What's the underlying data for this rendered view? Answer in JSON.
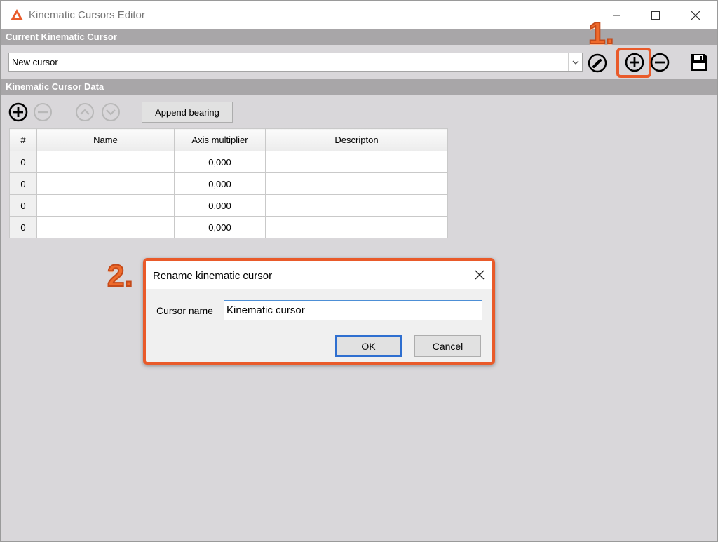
{
  "window": {
    "title": "Kinematic Cursors Editor"
  },
  "sections": {
    "current": "Current Kinematic Cursor",
    "data": "Kinematic Cursor Data"
  },
  "combo": {
    "value": "New cursor"
  },
  "toolbar": {
    "icons": [
      "edit-icon",
      "add-icon",
      "remove-icon",
      "save-icon"
    ]
  },
  "data_toolbar": {
    "append_label": "Append bearing"
  },
  "table": {
    "headers": [
      "#",
      "Name",
      "Axis multiplier",
      "Descripton"
    ],
    "rows": [
      {
        "idx": "0",
        "name": "",
        "mult": "0,000",
        "desc": ""
      },
      {
        "idx": "0",
        "name": "",
        "mult": "0,000",
        "desc": ""
      },
      {
        "idx": "0",
        "name": "",
        "mult": "0,000",
        "desc": ""
      },
      {
        "idx": "0",
        "name": "",
        "mult": "0,000",
        "desc": ""
      }
    ]
  },
  "annotations": {
    "step1": "1.",
    "step2": "2."
  },
  "dialog": {
    "title": "Rename kinematic cursor",
    "field_label": "Cursor name",
    "field_value": "Kinematic cursor",
    "ok": "OK",
    "cancel": "Cancel"
  },
  "colors": {
    "accent": "#e95a2a",
    "section_bar": "#a8a6a8",
    "background": "#d9d7da"
  }
}
